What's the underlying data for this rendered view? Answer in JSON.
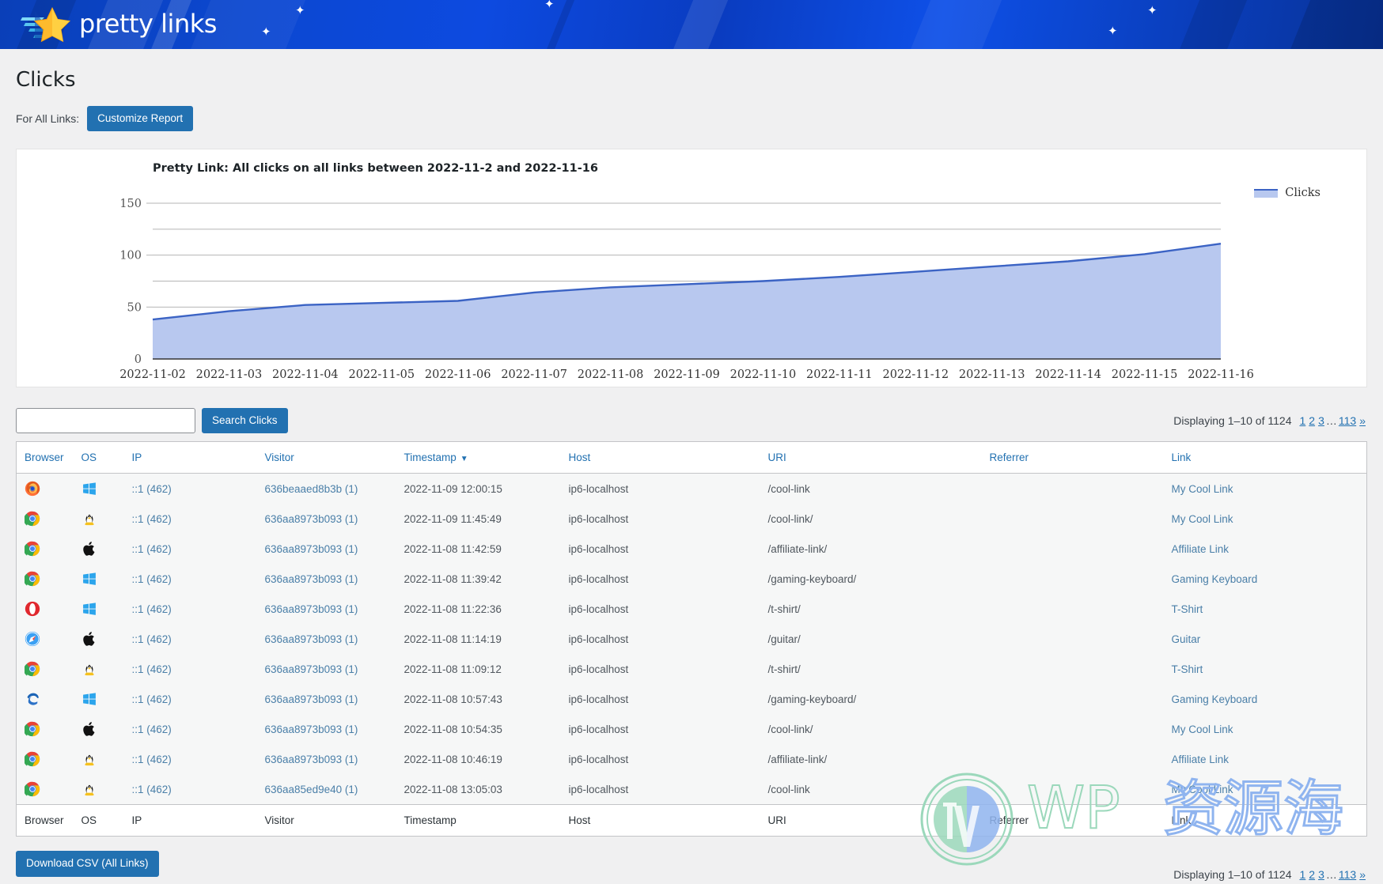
{
  "brand": {
    "name": "pretty links",
    "logo_icon": "star-swoosh-logo"
  },
  "page": {
    "title": "Clicks"
  },
  "toolbar": {
    "for_all_links_label": "For All Links:",
    "customize_report_label": "Customize Report"
  },
  "chart_data": {
    "type": "area",
    "title": "Pretty Link: All clicks on all links between 2022-11-2 and 2022-11-16",
    "xlabel": "",
    "ylabel": "",
    "ylim": [
      0,
      150
    ],
    "yticks": [
      0,
      50,
      100,
      150
    ],
    "grid": true,
    "legend_position": "right",
    "categories": [
      "2022-11-02",
      "2022-11-03",
      "2022-11-04",
      "2022-11-05",
      "2022-11-06",
      "2022-11-07",
      "2022-11-08",
      "2022-11-09",
      "2022-11-10",
      "2022-11-11",
      "2022-11-12",
      "2022-11-13",
      "2022-11-14",
      "2022-11-15",
      "2022-11-16"
    ],
    "series": [
      {
        "name": "Clicks",
        "color": "#3b63c4",
        "fill": "#b8c8ef",
        "values": [
          38,
          46,
          52,
          54,
          56,
          64,
          69,
          72,
          75,
          79,
          84,
          89,
          94,
          101,
          111
        ]
      }
    ]
  },
  "search": {
    "value": "",
    "placeholder": "",
    "button_label": "Search Clicks"
  },
  "pagination": {
    "displaying": "Displaying 1–10 of 1124",
    "pages": [
      "1",
      "2",
      "3"
    ],
    "dots": "…",
    "last_page": "113",
    "next_label": "»"
  },
  "table": {
    "columns": [
      "Browser",
      "OS",
      "IP",
      "Visitor",
      "Timestamp",
      "Host",
      "URI",
      "Referrer",
      "Link"
    ],
    "sorted_column": "Timestamp",
    "sort_arrow": "▼",
    "rows": [
      {
        "browser_icon": "firefox-icon",
        "os_icon": "windows-icon",
        "ip": "::1 (462)",
        "visitor": "636beaaed8b3b (1)",
        "timestamp": "2022-11-09 12:00:15",
        "host": "ip6-localhost",
        "uri": "/cool-link",
        "referrer": "",
        "link": "My Cool Link"
      },
      {
        "browser_icon": "chrome-icon",
        "os_icon": "linux-icon",
        "ip": "::1 (462)",
        "visitor": "636aa8973b093 (1)",
        "timestamp": "2022-11-09 11:45:49",
        "host": "ip6-localhost",
        "uri": "/cool-link/",
        "referrer": "",
        "link": "My Cool Link"
      },
      {
        "browser_icon": "chrome-icon",
        "os_icon": "apple-icon",
        "ip": "::1 (462)",
        "visitor": "636aa8973b093 (1)",
        "timestamp": "2022-11-08 11:42:59",
        "host": "ip6-localhost",
        "uri": "/affiliate-link/",
        "referrer": "",
        "link": "Affiliate Link"
      },
      {
        "browser_icon": "chrome-icon",
        "os_icon": "windows-icon",
        "ip": "::1 (462)",
        "visitor": "636aa8973b093 (1)",
        "timestamp": "2022-11-08 11:39:42",
        "host": "ip6-localhost",
        "uri": "/gaming-keyboard/",
        "referrer": "",
        "link": "Gaming Keyboard"
      },
      {
        "browser_icon": "opera-icon",
        "os_icon": "windows-icon",
        "ip": "::1 (462)",
        "visitor": "636aa8973b093 (1)",
        "timestamp": "2022-11-08 11:22:36",
        "host": "ip6-localhost",
        "uri": "/t-shirt/",
        "referrer": "",
        "link": "T-Shirt"
      },
      {
        "browser_icon": "safari-icon",
        "os_icon": "apple-icon",
        "ip": "::1 (462)",
        "visitor": "636aa8973b093 (1)",
        "timestamp": "2022-11-08 11:14:19",
        "host": "ip6-localhost",
        "uri": "/guitar/",
        "referrer": "",
        "link": "Guitar"
      },
      {
        "browser_icon": "chrome-icon",
        "os_icon": "linux-icon",
        "ip": "::1 (462)",
        "visitor": "636aa8973b093 (1)",
        "timestamp": "2022-11-08 11:09:12",
        "host": "ip6-localhost",
        "uri": "/t-shirt/",
        "referrer": "",
        "link": "T-Shirt"
      },
      {
        "browser_icon": "edge-icon",
        "os_icon": "windows-icon",
        "ip": "::1 (462)",
        "visitor": "636aa8973b093 (1)",
        "timestamp": "2022-11-08 10:57:43",
        "host": "ip6-localhost",
        "uri": "/gaming-keyboard/",
        "referrer": "",
        "link": "Gaming Keyboard"
      },
      {
        "browser_icon": "chrome-icon",
        "os_icon": "apple-icon",
        "ip": "::1 (462)",
        "visitor": "636aa8973b093 (1)",
        "timestamp": "2022-11-08 10:54:35",
        "host": "ip6-localhost",
        "uri": "/cool-link/",
        "referrer": "",
        "link": "My Cool Link"
      },
      {
        "browser_icon": "chrome-icon",
        "os_icon": "linux-icon",
        "ip": "::1 (462)",
        "visitor": "636aa8973b093 (1)",
        "timestamp": "2022-11-08 10:46:19",
        "host": "ip6-localhost",
        "uri": "/affiliate-link/",
        "referrer": "",
        "link": "Affiliate Link"
      },
      {
        "browser_icon": "chrome-icon",
        "os_icon": "linux-icon",
        "ip": "::1 (462)",
        "visitor": "636aa85ed9e40 (1)",
        "timestamp": "2022-11-08 13:05:03",
        "host": "ip6-localhost",
        "uri": "/cool-link",
        "referrer": "",
        "link": "My Cool Link"
      }
    ]
  },
  "footer": {
    "download_csv_label": "Download CSV (All Links)"
  },
  "watermark": {
    "latin": "WP",
    "cjk": "资源海",
    "logo_icon": "wordpress-icon"
  },
  "colors": {
    "accent": "#2271b1",
    "link": "#4a7fa8",
    "banner_blue": "#0b47d0",
    "chart_line": "#3b63c4",
    "chart_fill": "#b8c8ef"
  }
}
